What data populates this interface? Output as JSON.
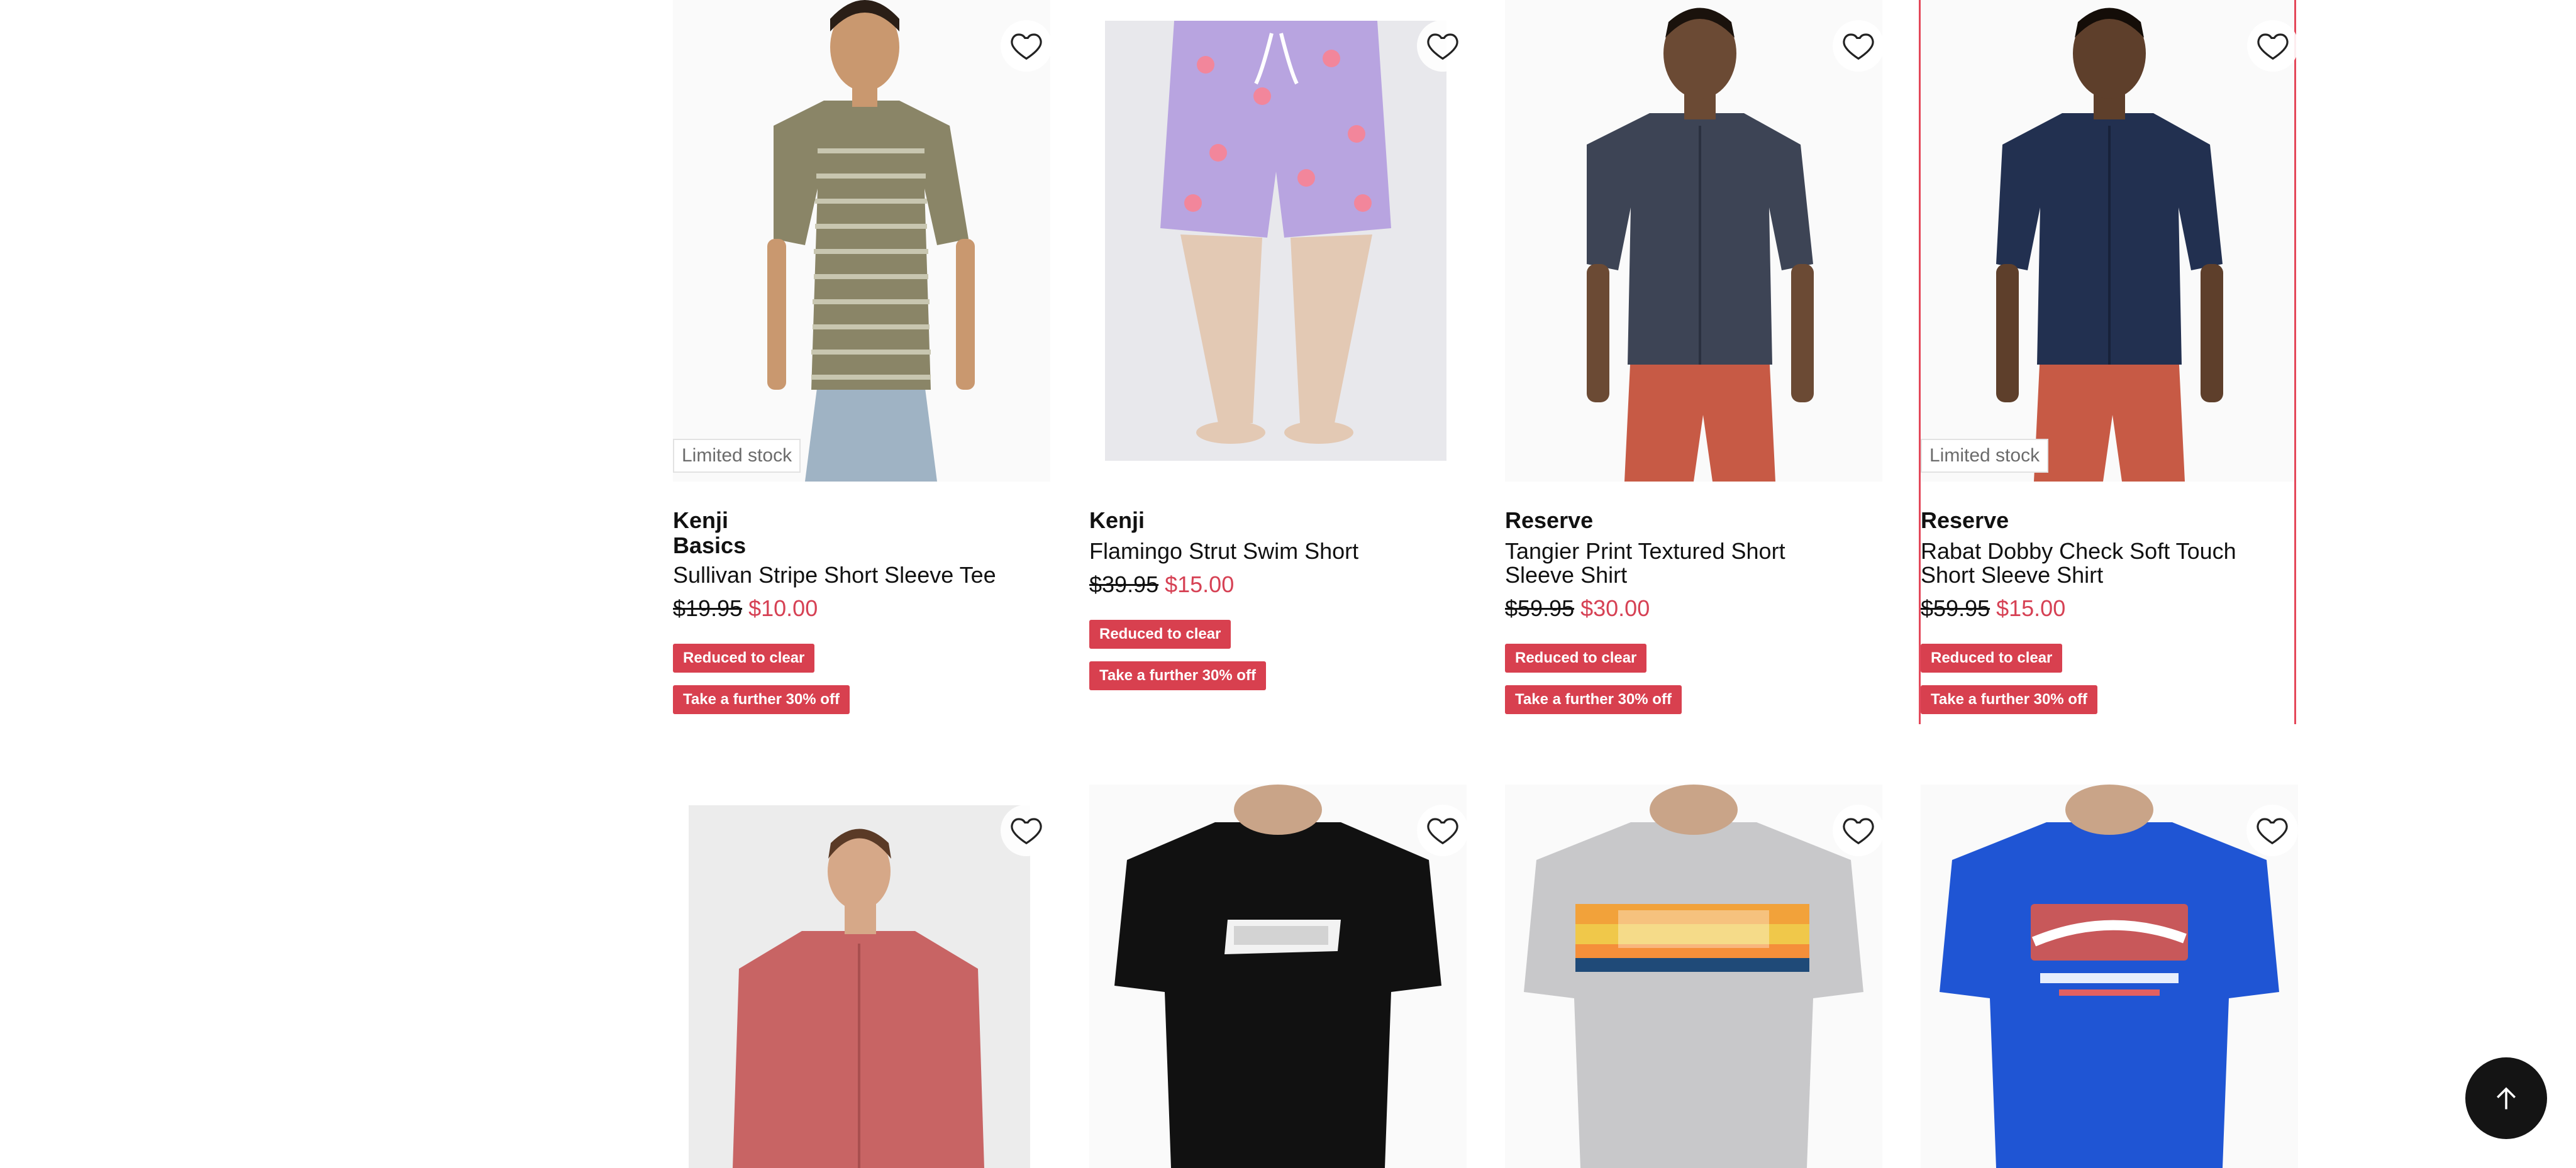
{
  "colors": {
    "sale_red": "#d8404f",
    "price_red": "#d64154",
    "hover_border": "#e4485a"
  },
  "products_row1": [
    {
      "badge": "Limited stock",
      "brand": "Kenji\nBasics",
      "name": "Sullivan Stripe Short Sleeve Tee",
      "was": "$19.95",
      "now": "$10.00",
      "tag1": "Reduced to clear",
      "tag2": "Take a further 30% off",
      "image": "striped-tee-model"
    },
    {
      "badge": "",
      "brand": "Kenji",
      "name": "Flamingo Strut Swim Short",
      "was": "$39.95",
      "now": "$15.00",
      "tag1": "Reduced to clear",
      "tag2": "Take a further 30% off",
      "image": "flamingo-swim-short"
    },
    {
      "badge": "",
      "brand": "Reserve",
      "name": "Tangier Print Textured Short Sleeve Shirt",
      "was": "$59.95",
      "now": "$30.00",
      "tag1": "Reduced to clear",
      "tag2": "Take a further 30% off",
      "image": "navy-shirt-model"
    },
    {
      "badge": "Limited stock",
      "brand": "Reserve",
      "name": "Rabat Dobby Check Soft Touch Short Sleeve Shirt",
      "was": "$59.95",
      "now": "$15.00",
      "tag1": "Reduced to clear",
      "tag2": "Take a further 30% off",
      "image": "navy-dobby-shirt-model"
    }
  ],
  "products_row2_images": [
    "red-linen-shirt-model",
    "black-superdry-tee",
    "grey-superdry-stripe-tee",
    "blue-superdry-vintage-tee"
  ],
  "icons": {
    "wishlist": "heart-outline-icon",
    "back_to_top": "arrow-up-icon"
  }
}
